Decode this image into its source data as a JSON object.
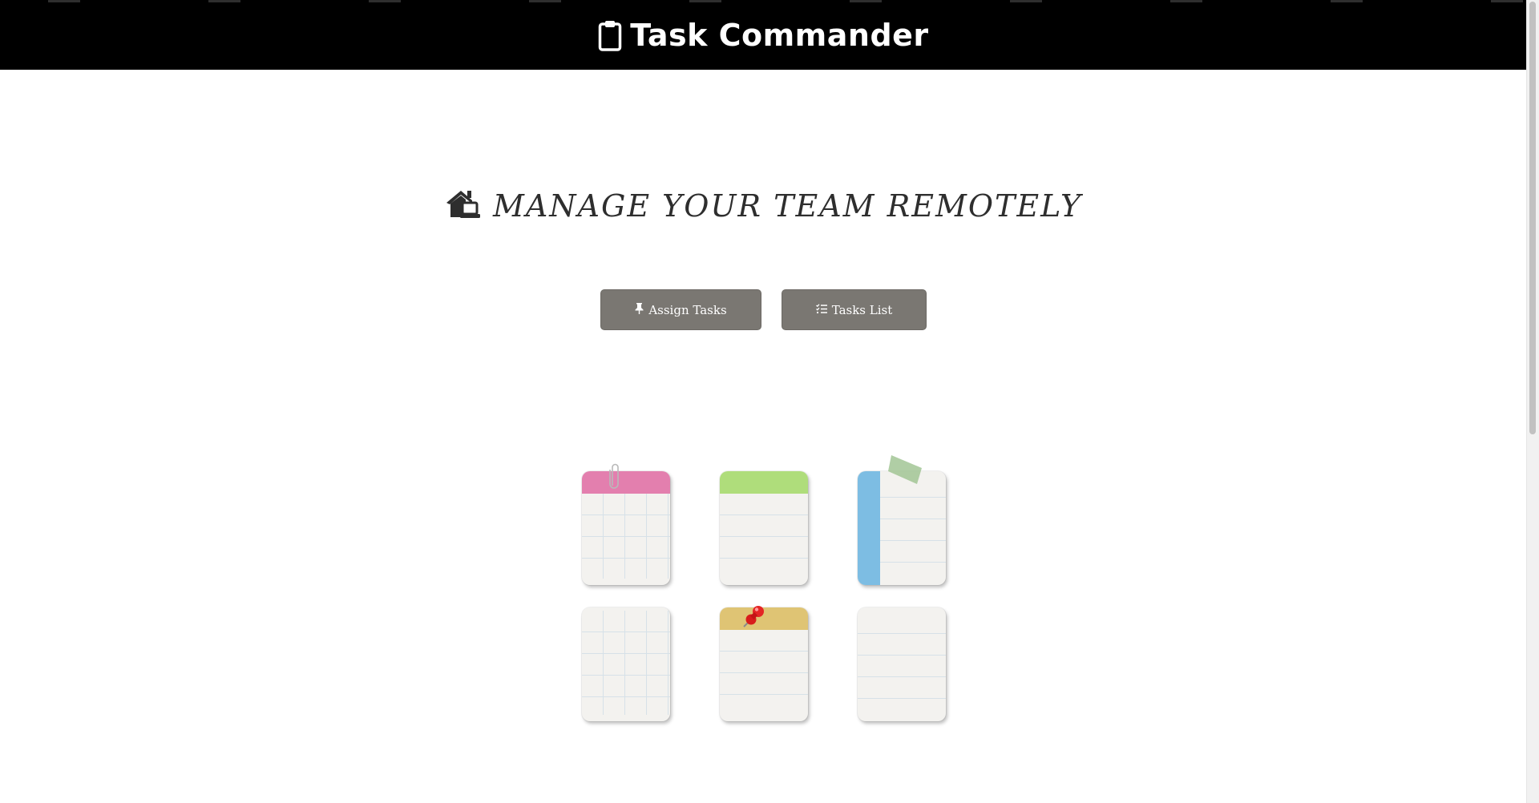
{
  "app": {
    "title": "Task Commander",
    "brand_icon": "clipboard-icon"
  },
  "hero": {
    "icon": "house-laptop-icon",
    "headline": "MANAGE YOUR TEAM REMOTELY"
  },
  "actions": {
    "assign": {
      "icon": "thumbtack-icon",
      "label": "Assign Tasks"
    },
    "list": {
      "icon": "list-check-icon",
      "label": "Tasks List"
    }
  },
  "notes": [
    {
      "style": "grid-paper",
      "header_color": "#e37fae",
      "decoration": "paperclip-icon"
    },
    {
      "style": "lines",
      "header_color": "#afdd7b",
      "decoration": ""
    },
    {
      "style": "plain-lines",
      "spine_color": "#7dbde3",
      "decoration": "tape-icon"
    },
    {
      "style": "grid-full",
      "decoration": ""
    },
    {
      "style": "lines",
      "header_color": "#dfc474",
      "decoration": "pushpin-icon"
    },
    {
      "style": "plain-lines",
      "decoration": ""
    }
  ],
  "colors": {
    "topbar": "#000000",
    "button_bg": "#7a7772",
    "note_paper": "#f3f2ef"
  }
}
